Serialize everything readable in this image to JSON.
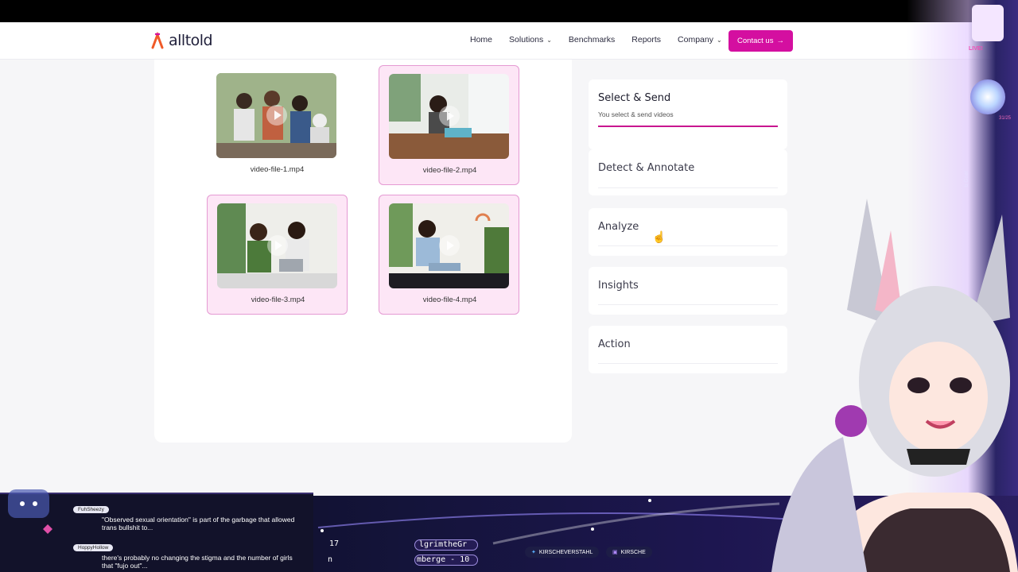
{
  "header": {
    "logo_text": "alltold",
    "nav": [
      {
        "label": "Home",
        "dropdown": false
      },
      {
        "label": "Solutions",
        "dropdown": true
      },
      {
        "label": "Benchmarks",
        "dropdown": false
      },
      {
        "label": "Reports",
        "dropdown": false
      },
      {
        "label": "Company",
        "dropdown": true
      }
    ],
    "cta_label": "Contact us",
    "cta_arrow": "→"
  },
  "videos": [
    {
      "label": "video-file-1.mp4",
      "selected": false
    },
    {
      "label": "video-file-2.mp4",
      "selected": true
    },
    {
      "label": "video-file-3.mp4",
      "selected": true
    },
    {
      "label": "video-file-4.mp4",
      "selected": true
    }
  ],
  "steps": [
    {
      "title": "Select & Send",
      "subtitle": "You select & send videos",
      "active": true
    },
    {
      "title": "Detect & Annotate",
      "active": false
    },
    {
      "title": "Analyze",
      "active": false
    },
    {
      "title": "Insights",
      "active": false
    },
    {
      "title": "Action",
      "active": false
    }
  ],
  "overlay": {
    "live_label": "LIVE!",
    "goal_label": "b Goal",
    "sub_count": "31/25",
    "chat": [
      {
        "user": "FuhSheezy",
        "text": "\"Observed sexual orientation\" is part of the garbage that allowed trans bullshit to..."
      },
      {
        "user": "HoppyHollow",
        "text": "there's probably no changing the stigma and the number of girls that \"fujo out\"..."
      }
    ],
    "ticker": [
      "17",
      "n",
      "lgrimtheGr",
      "mberge - 10"
    ],
    "socials": [
      "KIRSCHEVERSTAHL",
      "KIRSCHE"
    ]
  },
  "colors": {
    "brand": "#d40fa0",
    "selected_bg": "#fde6f6",
    "selected_border": "#e59ad3",
    "active_underline": "#c8168f"
  }
}
